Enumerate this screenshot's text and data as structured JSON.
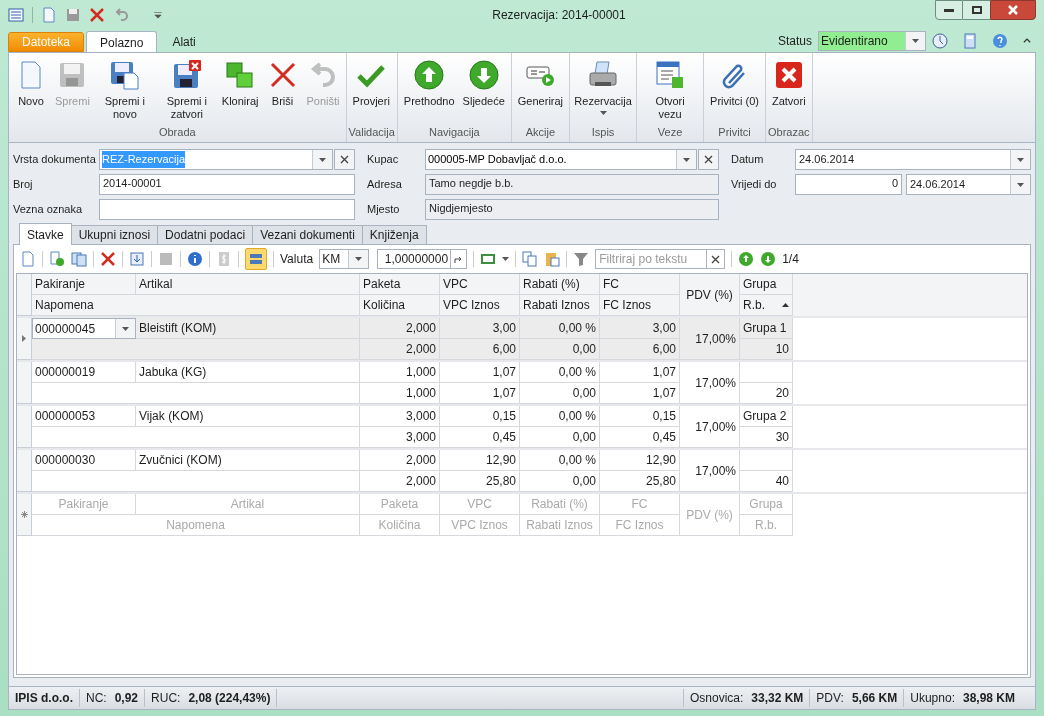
{
  "window": {
    "title": "Rezervacija: 2014-00001"
  },
  "ribbon_tabs": [
    {
      "label": "Datoteka",
      "kind": "file",
      "selected": false
    },
    {
      "label": "Polazno",
      "kind": "tab",
      "selected": true
    },
    {
      "label": "Alati",
      "kind": "tab",
      "selected": false
    }
  ],
  "status": {
    "label": "Status",
    "value": "Evidentirano"
  },
  "ribbon_groups": [
    {
      "label": "Obrada",
      "buttons": [
        {
          "label": "Novo",
          "kind": "new",
          "disabled": false
        },
        {
          "label": "Spremi",
          "kind": "save",
          "disabled": true
        },
        {
          "label": "Spremi i novo",
          "kind": "save-new",
          "disabled": false
        },
        {
          "label": "Spremi i zatvori",
          "kind": "save-close",
          "disabled": false
        },
        {
          "label": "Kloniraj",
          "kind": "clone",
          "disabled": false
        },
        {
          "label": "Briši",
          "kind": "delete",
          "disabled": false
        },
        {
          "label": "Poništi",
          "kind": "undo",
          "disabled": true
        }
      ]
    },
    {
      "label": "Validacija",
      "buttons": [
        {
          "label": "Provjeri",
          "kind": "check",
          "disabled": false
        }
      ]
    },
    {
      "label": "Navigacija",
      "buttons": [
        {
          "label": "Prethodno",
          "kind": "up",
          "disabled": false
        },
        {
          "label": "Sljedeće",
          "kind": "down",
          "disabled": false
        }
      ]
    },
    {
      "label": "Akcije",
      "buttons": [
        {
          "label": "Generiraj",
          "kind": "generate",
          "disabled": false
        }
      ]
    },
    {
      "label": "Ispis",
      "buttons": [
        {
          "label": "Rezervacija",
          "kind": "print",
          "disabled": false,
          "dropdown": true
        }
      ]
    },
    {
      "label": "Veze",
      "buttons": [
        {
          "label": "Otvori vezu",
          "kind": "open-link",
          "disabled": false
        }
      ]
    },
    {
      "label": "Privitci",
      "buttons": [
        {
          "label": "Privitci (0)",
          "kind": "attach",
          "disabled": false
        }
      ]
    },
    {
      "label": "Obrazac",
      "buttons": [
        {
          "label": "Zatvori",
          "kind": "close",
          "disabled": false
        }
      ]
    }
  ],
  "form": {
    "columns": [
      [
        {
          "label": "Vrsta dokumenta",
          "value": "REZ-Rezervacija",
          "kind": "combo",
          "text_selected": true
        },
        {
          "label": "Broj",
          "value": "2014-00001",
          "kind": "text"
        },
        {
          "label": "Vezna oznaka",
          "kind": "text"
        }
      ],
      [
        {
          "label": "Kupac",
          "value": "000005-MP Dobavljač d.o.o.",
          "kind": "combo",
          "text_selected": false
        },
        {
          "label": "Adresa",
          "value": "Tamo negdje b.b.",
          "kind": "readonly"
        },
        {
          "label": "Mjesto",
          "value": "Nigdjemjesto",
          "kind": "readonly"
        }
      ],
      [
        {
          "label": "Datum",
          "value": "24.06.2014",
          "kind": "date"
        },
        {
          "label": "Vrijedi do",
          "days": "0",
          "value": "24.06.2014",
          "kind": "days-date"
        }
      ]
    ]
  },
  "inner_tabs": [
    {
      "label": "Stavke",
      "selected": true
    },
    {
      "label": "Ukupni iznosi",
      "selected": false
    },
    {
      "label": "Dodatni podaci",
      "selected": false
    },
    {
      "label": "Vezani dokumenti",
      "selected": false
    },
    {
      "label": "Knjiženja",
      "selected": false
    }
  ],
  "grid_toolbar": {
    "layout_toggle": {
      "on": true
    },
    "currency_label": "Valuta",
    "currency": "KM",
    "rate": "1,00000000",
    "filter_placeholder": "Filtriraj po tekstu",
    "counter": "1/4"
  },
  "grid": {
    "header": {
      "line_1": [
        "Pakiranje",
        "Artikal",
        "Paketa",
        "VPC",
        "Rabati (%)",
        "FC",
        "PDV (%)",
        "Grupa"
      ],
      "line_2": [
        "Napomena",
        "Količina",
        "VPC Iznos",
        "Rabati Iznos",
        "FC Iznos",
        "R.b."
      ],
      "sort_ascending": true
    },
    "rows": [
      {
        "selected": true,
        "pakiranje": "000000045",
        "artikal": "Bleistift (KOM)",
        "paketa": "2,000",
        "vpc": "3,00",
        "rabati": "0,00 %",
        "fc": "3,00",
        "pdv": "17,00%",
        "grupa": "Grupa 1",
        "kolicina": "2,000",
        "vpc_iznos": "6,00",
        "rabati_iznos": "0,00",
        "fc_iznos": "6,00",
        "rb": "10"
      },
      {
        "selected": false,
        "pakiranje": "000000019",
        "artikal": "Jabuka (KG)",
        "paketa": "1,000",
        "vpc": "1,07",
        "rabati": "0,00 %",
        "fc": "1,07",
        "pdv": "17,00%",
        "kolicina": "1,000",
        "vpc_iznos": "1,07",
        "rabati_iznos": "0,00",
        "fc_iznos": "1,07",
        "rb": "20"
      },
      {
        "selected": false,
        "pakiranje": "000000053",
        "artikal": "Vijak (KOM)",
        "paketa": "3,000",
        "vpc": "0,15",
        "rabati": "0,00 %",
        "fc": "0,15",
        "pdv": "17,00%",
        "grupa": "Grupa 2",
        "kolicina": "3,000",
        "vpc_iznos": "0,45",
        "rabati_iznos": "0,00",
        "fc_iznos": "0,45",
        "rb": "30"
      },
      {
        "selected": false,
        "pakiranje": "000000030",
        "artikal": "Zvučnici (KOM)",
        "paketa": "2,000",
        "vpc": "12,90",
        "rabati": "0,00 %",
        "fc": "12,90",
        "pdv": "17,00%",
        "kolicina": "2,000",
        "vpc_iznos": "25,80",
        "rabati_iznos": "0,00",
        "fc_iznos": "25,80",
        "rb": "40"
      }
    ],
    "new_row": {
      "line_1": [
        "Pakiranje",
        "Artikal",
        "Paketa",
        "VPC",
        "Rabati (%)",
        "FC",
        "PDV (%)",
        "Grupa"
      ],
      "line_2": [
        "Napomena",
        "Količina",
        "VPC Iznos",
        "Rabati Iznos",
        "FC Iznos",
        "R.b."
      ]
    }
  },
  "status_bar": {
    "company": "IPIS d.o.o.",
    "left": [
      {
        "label": "NC:",
        "value": "0,92"
      },
      {
        "label": "RUC:",
        "value": "2,08 (224,43%)"
      }
    ],
    "right": [
      {
        "label": "Osnovica:",
        "value": "33,32 KM"
      },
      {
        "label": "PDV:",
        "value": "5,66 KM"
      },
      {
        "label": "Ukupno:",
        "value": "38,98 KM"
      }
    ]
  }
}
